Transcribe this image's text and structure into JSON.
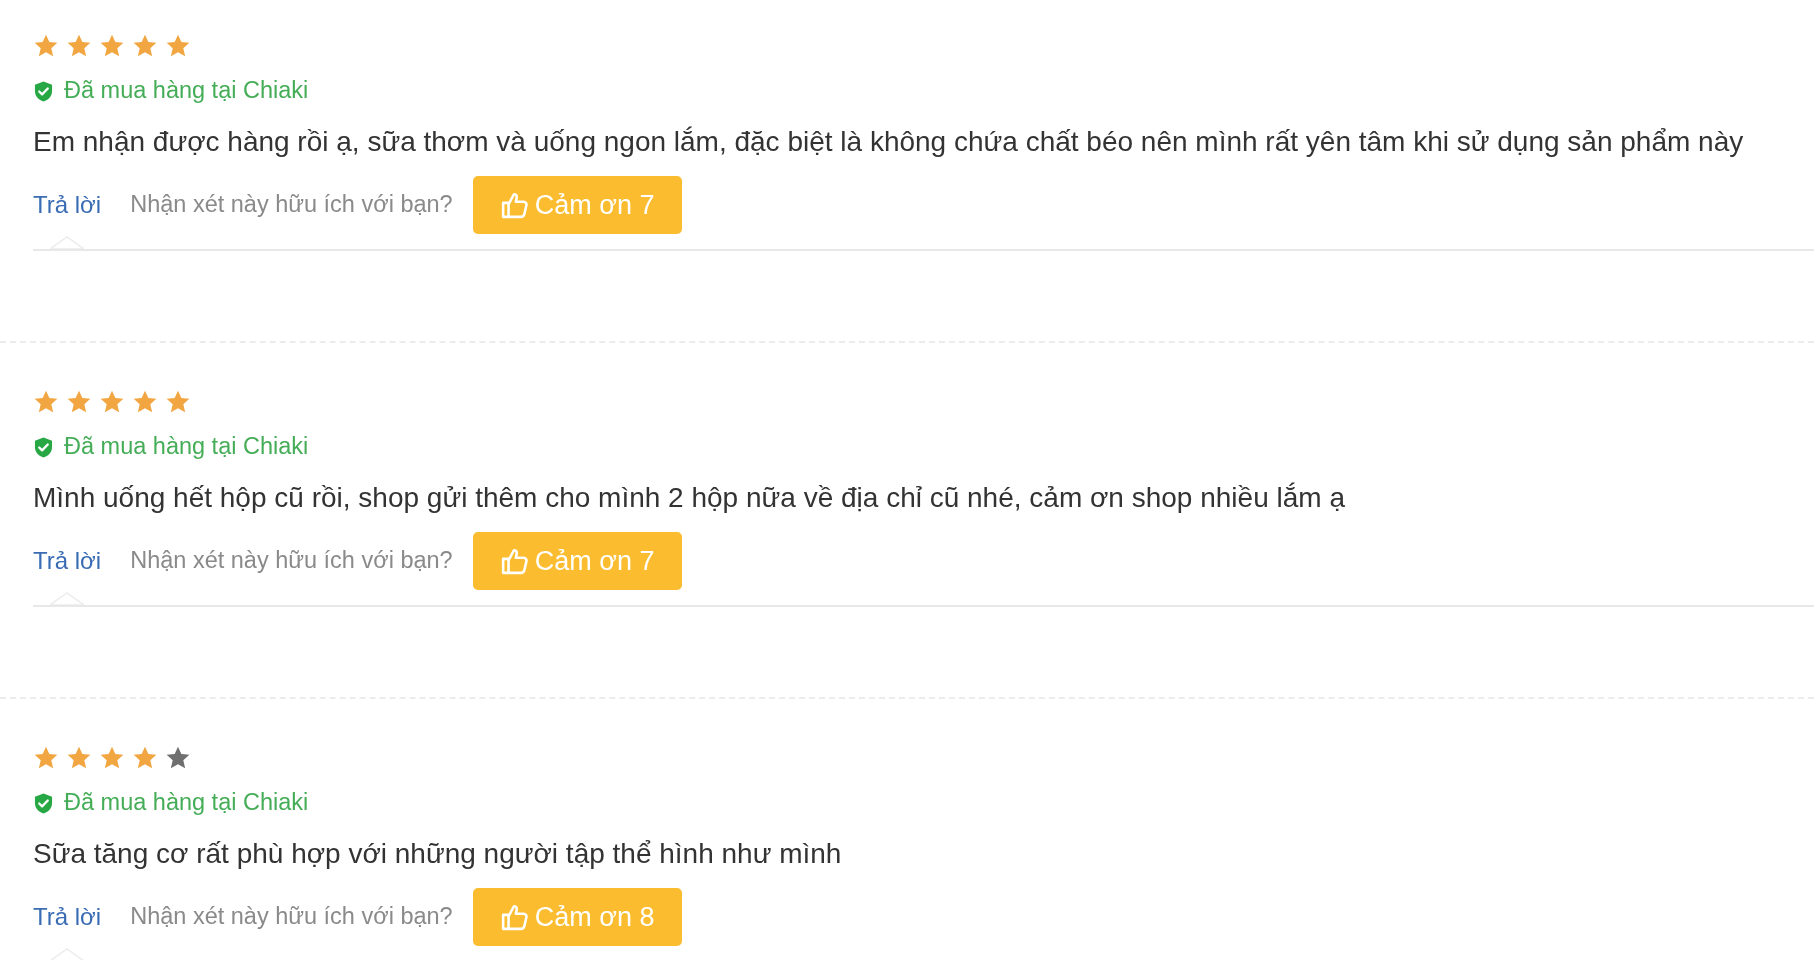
{
  "reviews": [
    {
      "stars": 5,
      "verified_label": "Đã mua hàng tại Chiaki",
      "text": "Em nhận được hàng rồi ạ, sữa thơm và uống ngon lắm, đặc biệt là không chứa chất béo nên mình rất yên tâm khi sử dụng sản phẩm này",
      "reply_link": "Trả lời",
      "helpful_prompt": "Nhận xét này hữu ích với bạn?",
      "thanks_button": "Cảm ơn 7"
    },
    {
      "stars": 5,
      "verified_label": "Đã mua hàng tại Chiaki",
      "text": "Mình uống hết hộp cũ rồi, shop gửi thêm cho mình 2 hộp nữa về địa chỉ cũ nhé, cảm ơn shop nhiều lắm ạ",
      "reply_link": "Trả lời",
      "helpful_prompt": "Nhận xét này hữu ích với bạn?",
      "thanks_button": "Cảm ơn 7"
    },
    {
      "stars": 4,
      "verified_label": "Đã mua hàng tại Chiaki",
      "text": "Sữa tăng cơ rất phù hợp với những người tập thể hình như mình",
      "reply_link": "Trả lời",
      "helpful_prompt": "Nhận xét này hữu ích với bạn?",
      "thanks_button": "Cảm ơn 8"
    }
  ]
}
